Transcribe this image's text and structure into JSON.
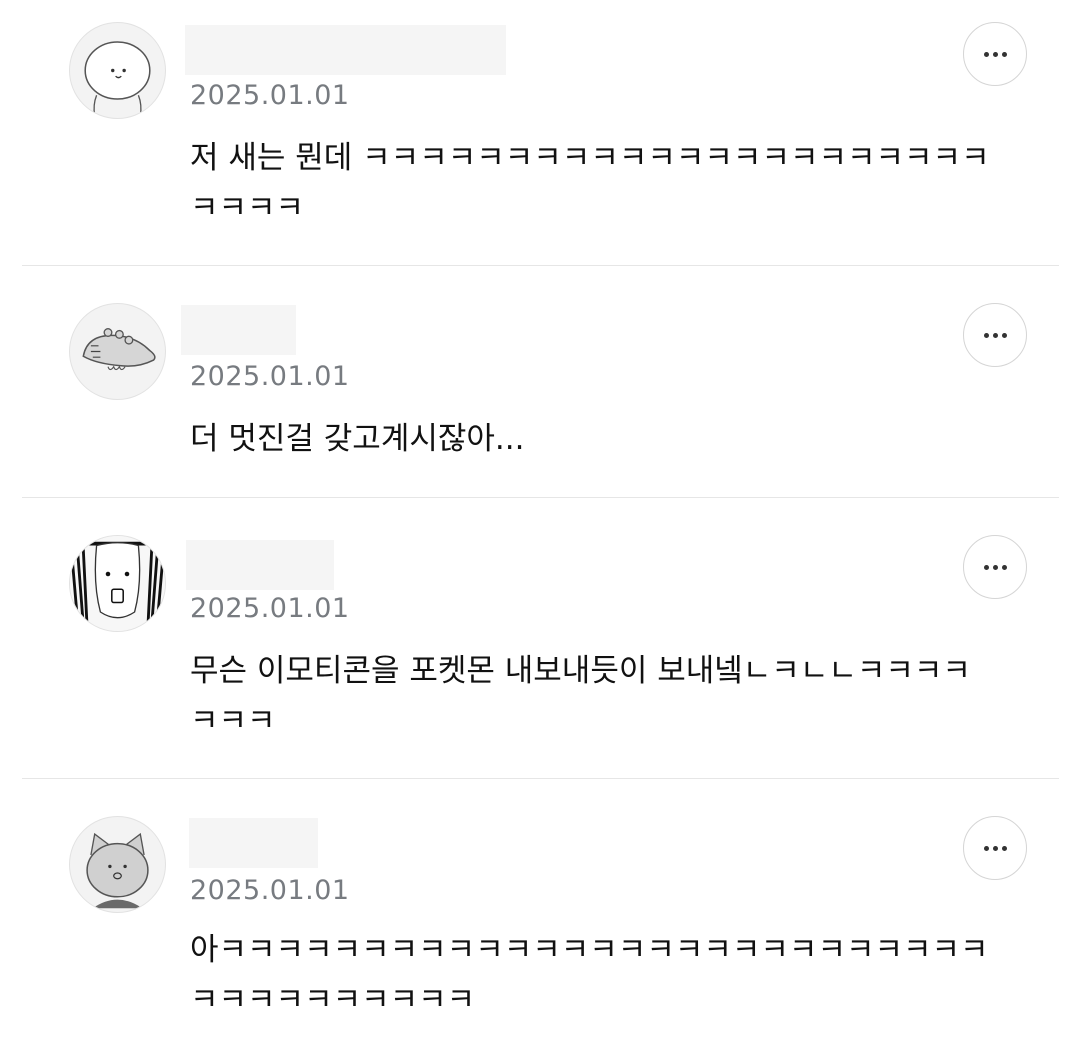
{
  "comments": [
    {
      "date": "2025.01.01",
      "text": "저 새는 뭔데 ㅋㅋㅋㅋㅋㅋㅋㅋㅋㅋㅋㅋㅋㅋㅋㅋㅋㅋㅋㅋㅋㅋㅋㅋㅋㅋ",
      "avatar_icon": "bunny-face-avatar-icon"
    },
    {
      "date": "2025.01.01",
      "text": "더 멋진걸 갖고계시잖아...",
      "avatar_icon": "dinosaur-avatar-icon"
    },
    {
      "date": "2025.01.01",
      "text": "무슨 이모티콘을 포켓몬 내보내듯이 보내넼ㄴㅋㄴㄴㅋㅋㅋㅋㅋㅋㅋ",
      "avatar_icon": "screaming-dog-avatar-icon"
    },
    {
      "date": "2025.01.01",
      "text": "아ㅋㅋㅋㅋㅋㅋㅋㅋㅋㅋㅋㅋㅋㅋㅋㅋㅋㅋㅋㅋㅋㅋㅋㅋㅋㅋㅋㅋㅋㅋㅋㅋㅋㅋㅋㅋㅋ",
      "avatar_icon": "cat-avatar-icon"
    }
  ],
  "more_button_icon": "more-horizontal-icon"
}
